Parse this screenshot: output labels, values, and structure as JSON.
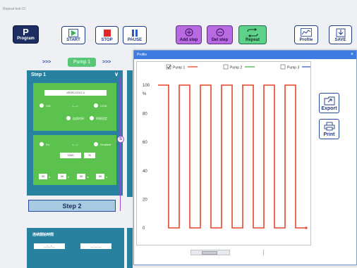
{
  "window": {
    "title": "Repeat test 01"
  },
  "toolbar": {
    "program": "Program",
    "program_letter": "P",
    "start": "START",
    "stop": "STOP",
    "pause": "PAUSE",
    "add_step": "Add step",
    "del_step": "Del step",
    "repeat": "Repeat",
    "profile": "Profile",
    "save": "SAVE"
  },
  "pump_nav": {
    "left_arrows": ">>>",
    "label": "Pump 1",
    "right_arrows": ">>>"
  },
  "step1": {
    "title": "Step 1",
    "rate_field": "1ΦOE-C01C-1",
    "cw_label": "CW",
    "arrow_mid": "<--->",
    "ccw_label": "CCW",
    "opt_a": "连续时间",
    "opt_b": "时间设定",
    "fix_label": "Fix",
    "gradient_label": "Gradient",
    "value_field": "1000",
    "unit_field": "%",
    "time_fields": [
      "00",
      "00",
      "00",
      "00"
    ],
    "time_units": [
      "d",
      "h",
      "m",
      "s"
    ]
  },
  "step2": {
    "title": "Step 2"
  },
  "bottom_panel": {
    "title": "连续開始時間",
    "date1": "__/__/__",
    "date2": "__:__:__"
  },
  "s_badge": "S",
  "dialog": {
    "title": "Profile",
    "close": "×",
    "export": "Export",
    "print": "Print"
  },
  "colors": {
    "pump1": "#e8452a",
    "pump2": "#4caf50",
    "pump3": "#3b5fc7",
    "accent": "#3c7be0"
  },
  "chart_data": {
    "type": "line",
    "title": "",
    "xlabel": "",
    "ylabel": "%",
    "ylim": [
      0,
      100
    ],
    "yticks": [
      "100",
      "80",
      "60",
      "40",
      "20",
      "0"
    ],
    "legend": [
      {
        "name": "Pump 1",
        "checked": true,
        "color": "#e8452a"
      },
      {
        "name": "Pump 2",
        "checked": false,
        "color": "#4caf50"
      },
      {
        "name": "Pump 3",
        "checked": false,
        "color": "#3b5fc7"
      }
    ],
    "series": [
      {
        "name": "Pump 1",
        "x": [
          0,
          1,
          1,
          2,
          2,
          3,
          3,
          4,
          4,
          5,
          5,
          6,
          6,
          7,
          7,
          8,
          8,
          9,
          9,
          10,
          10,
          11,
          11,
          12,
          12,
          13,
          13,
          14
        ],
        "values": [
          100,
          100,
          0,
          0,
          100,
          100,
          0,
          0,
          100,
          100,
          0,
          0,
          100,
          100,
          0,
          0,
          100,
          100,
          0,
          0,
          100,
          100,
          0,
          0,
          100,
          100,
          0,
          0
        ]
      }
    ]
  }
}
